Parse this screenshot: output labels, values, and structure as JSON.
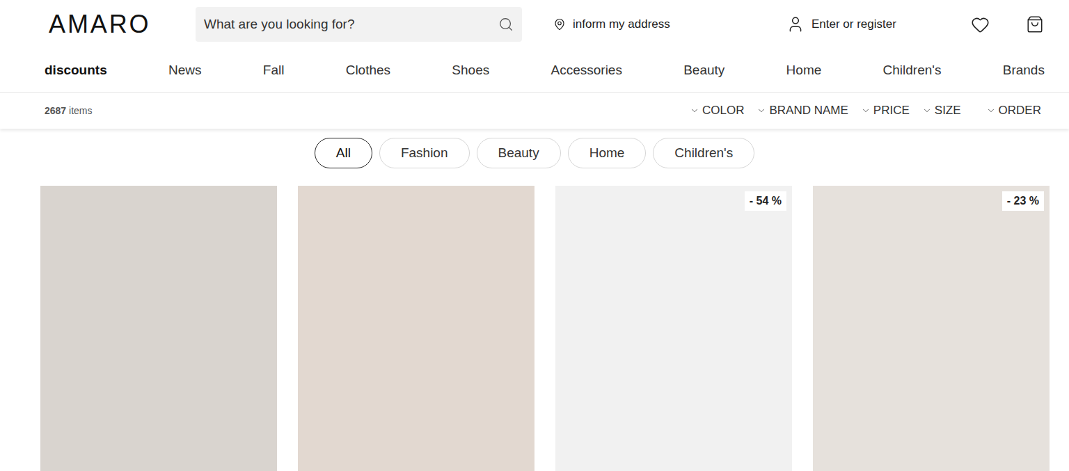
{
  "header": {
    "logo": "AMARO",
    "search": {
      "placeholder": "What are you looking for?"
    },
    "address": "inform my address",
    "account": "Enter or register"
  },
  "nav": [
    {
      "label": "discounts",
      "selected": true
    },
    {
      "label": "News",
      "selected": false
    },
    {
      "label": "Fall",
      "selected": false
    },
    {
      "label": "Clothes",
      "selected": false
    },
    {
      "label": "Shoes",
      "selected": false
    },
    {
      "label": "Accessories",
      "selected": false
    },
    {
      "label": "Beauty",
      "selected": false
    },
    {
      "label": "Home",
      "selected": false
    },
    {
      "label": "Children's",
      "selected": false
    },
    {
      "label": "Brands",
      "selected": false
    }
  ],
  "toolbar": {
    "count": "2687",
    "count_label": "items",
    "filters": [
      "COLOR",
      "BRAND NAME",
      "PRICE",
      "SIZE",
      "ORDER"
    ]
  },
  "categories": [
    {
      "label": "All",
      "selected": true
    },
    {
      "label": "Fashion",
      "selected": false
    },
    {
      "label": "Beauty",
      "selected": false
    },
    {
      "label": "Home",
      "selected": false
    },
    {
      "label": "Children's",
      "selected": false
    }
  ],
  "products": [
    {
      "color": "#d9d4cf"
    },
    {
      "color": "#e2d8d0"
    },
    {
      "color": "#f1f1f1",
      "badge": "- 54 %"
    },
    {
      "color": "#e6e1dc",
      "badge": "- 23 %"
    }
  ]
}
